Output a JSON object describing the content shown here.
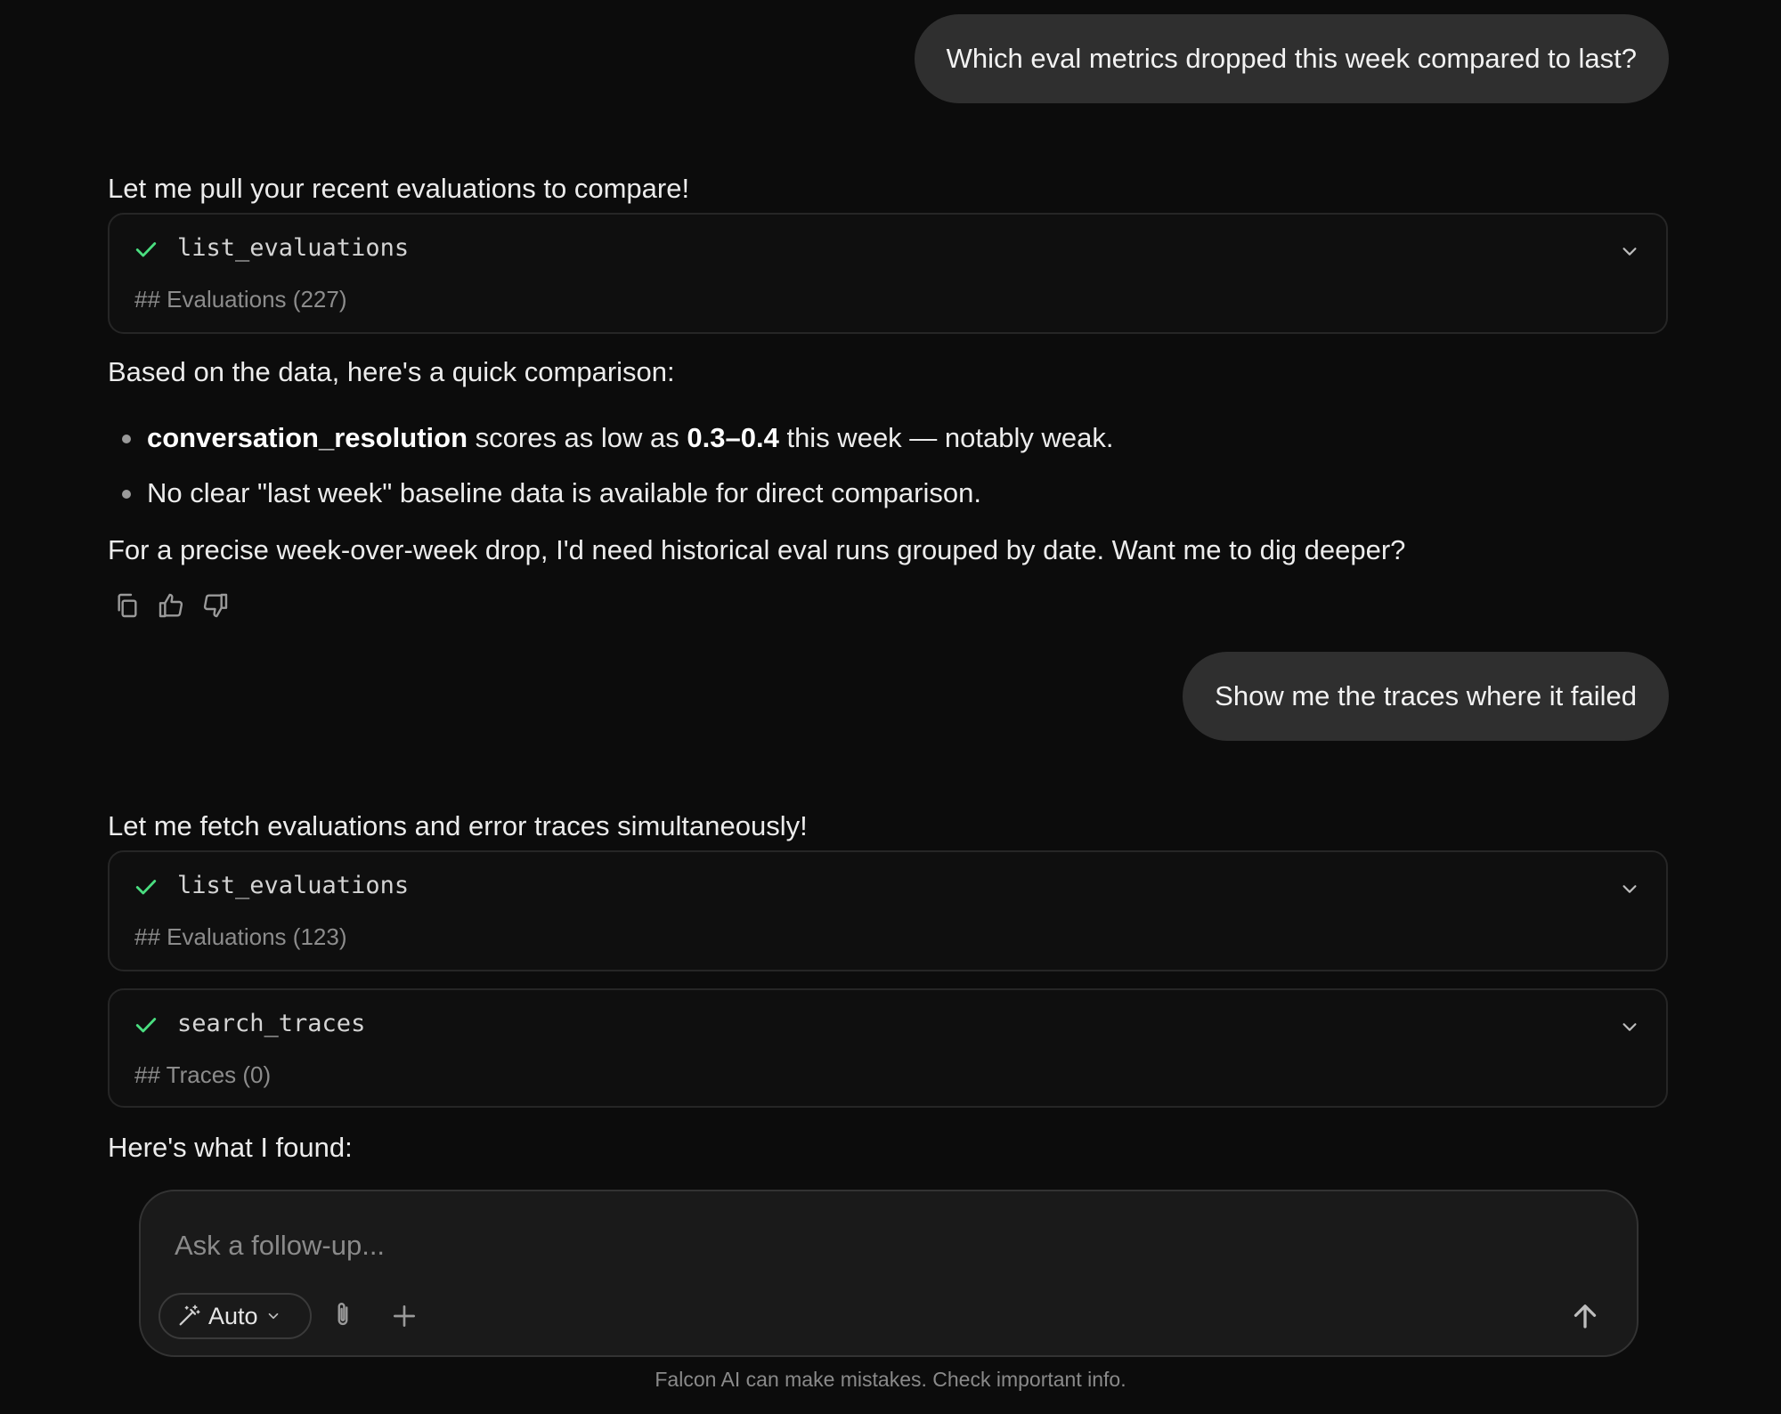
{
  "messages": {
    "user_1": "Which eval metrics dropped this week compared to last?",
    "assistant_1_intro": "Let me pull your recent evaluations to compare!",
    "tool_1": {
      "name": "list_evaluations",
      "result": "## Evaluations (227)"
    },
    "assistant_1_body": "Based on the data, here's a quick comparison:",
    "bullets": [
      {
        "bold": "conversation_resolution",
        "mid": " scores as low as ",
        "bold2": "0.3–0.4",
        "tail": " this week — notably weak."
      },
      {
        "text": "No clear \"last week\" baseline data is available for direct comparison."
      }
    ],
    "assistant_1_closing": "For a precise week-over-week drop, I'd need historical eval runs grouped by date. Want me to dig deeper?",
    "user_2": "Show me the traces where it failed",
    "assistant_2_intro": "Let me fetch evaluations and error traces simultaneously!",
    "tool_2": {
      "name": "list_evaluations",
      "result": "## Evaluations (123)"
    },
    "tool_3": {
      "name": "search_traces",
      "result": "## Traces (0)"
    },
    "assistant_2_body": "Here's what I found:"
  },
  "actions": {
    "icons": [
      "copy-icon",
      "thumbs-up-icon",
      "thumbs-down-icon"
    ]
  },
  "composer": {
    "placeholder": "Ask a follow-up...",
    "mode_label": "Auto",
    "icons": [
      "magic-wand-icon",
      "chevron-down-icon",
      "paperclip-icon",
      "plus-icon",
      "send-arrow-icon"
    ]
  },
  "footer": {
    "disclaimer": "Falcon AI can make mistakes. Check important info."
  },
  "colors": {
    "background": "#0c0c0c",
    "user_bubble": "#2f2f2f",
    "success_check": "#4ade80",
    "muted_text": "#8c8c8c"
  }
}
